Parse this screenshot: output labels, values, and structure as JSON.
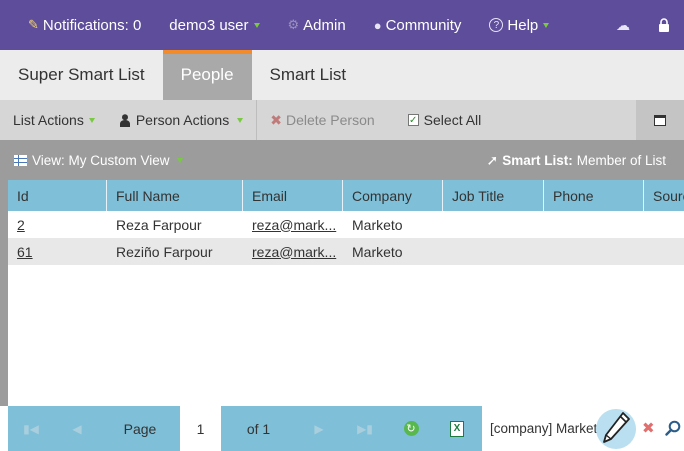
{
  "topbar": {
    "notifications": "Notifications: 0",
    "user": "demo3 user",
    "admin": "Admin",
    "community": "Community",
    "help": "Help"
  },
  "tabs": [
    {
      "label": "Super Smart List",
      "active": false
    },
    {
      "label": "People",
      "active": true
    },
    {
      "label": "Smart List",
      "active": false
    }
  ],
  "toolbar": {
    "list_actions": "List Actions",
    "person_actions": "Person Actions",
    "delete_person": "Delete Person",
    "select_all": "Select All"
  },
  "viewbar": {
    "view": "View: My Custom View",
    "smart_list_label": "Smart List:",
    "smart_list_value": "Member of List"
  },
  "table": {
    "columns": [
      "Id",
      "Full Name",
      "Email",
      "Company",
      "Job Title",
      "Phone",
      "Source"
    ],
    "rows": [
      {
        "id": "2",
        "full_name": "Reza Farpour",
        "email": "reza@mark...",
        "company": "Marketo",
        "job_title": "",
        "phone": ""
      },
      {
        "id": "61",
        "full_name": "Reziño Farpour",
        "email": "reza@mark...",
        "company": "Marketo",
        "job_title": "",
        "phone": ""
      }
    ]
  },
  "pager": {
    "page_label": "Page",
    "page_value": "1",
    "of_label": "of 1",
    "filter_text": "[company] Marketo"
  },
  "colors": {
    "topbar": "#5d4d9a",
    "tab_accent": "#f28b2c",
    "table_header": "#7fbfd7",
    "arrow_green": "#7ac943"
  }
}
